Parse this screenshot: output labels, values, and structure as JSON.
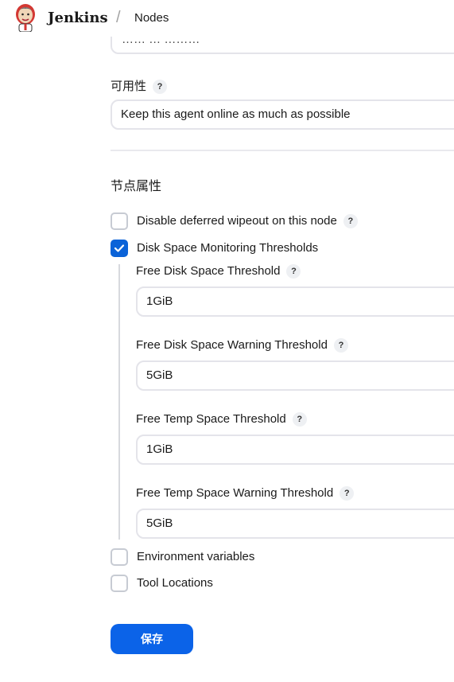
{
  "header": {
    "brand": "Jenkins",
    "separator": "/",
    "breadcrumb": "Nodes"
  },
  "top_field": {
    "partial_value": "…… … ………"
  },
  "availability": {
    "label": "可用性",
    "help": "?",
    "value": "Keep this agent online as much as possible"
  },
  "node_properties": {
    "title": "节点属性",
    "disable_deferred_wipeout": {
      "label": "Disable deferred wipeout on this node",
      "help": "?",
      "checked": false
    },
    "disk_space_monitoring": {
      "label": "Disk Space Monitoring Thresholds",
      "checked": true,
      "fields": [
        {
          "label": "Free Disk Space Threshold",
          "help": "?",
          "value": "1GiB"
        },
        {
          "label": "Free Disk Space Warning Threshold",
          "help": "?",
          "value": "5GiB"
        },
        {
          "label": "Free Temp Space Threshold",
          "help": "?",
          "value": "1GiB"
        },
        {
          "label": "Free Temp Space Warning Threshold",
          "help": "?",
          "value": "5GiB"
        }
      ]
    },
    "environment_variables": {
      "label": "Environment variables",
      "checked": false
    },
    "tool_locations": {
      "label": "Tool Locations",
      "checked": false
    }
  },
  "save_button": "保存",
  "colors": {
    "accent": "#0b63e8",
    "field_border": "#e4e4ea",
    "help_bg": "#eef0f3"
  }
}
